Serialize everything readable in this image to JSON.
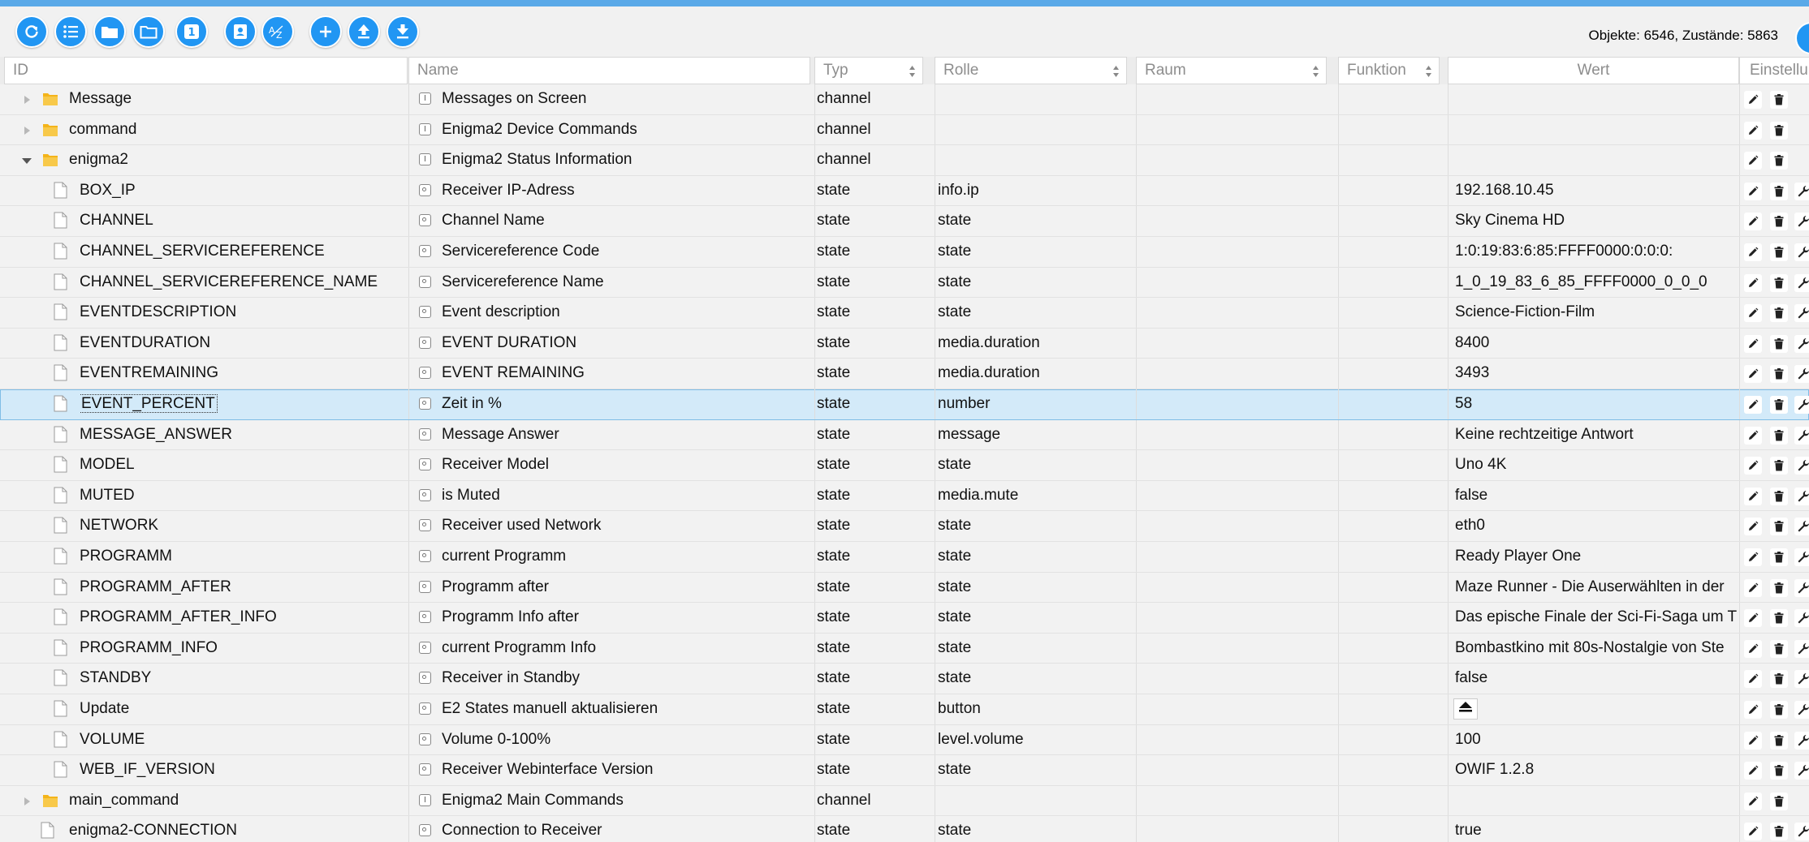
{
  "status": {
    "objects_label": "Objekte: 6546, Zustände: 5863"
  },
  "toolbar": {
    "buttons": [
      {
        "name": "refresh-button",
        "icon": "refresh-icon"
      },
      {
        "name": "list-view-button",
        "icon": "list-icon"
      },
      {
        "name": "folder-closed-button",
        "icon": "folder-icon"
      },
      {
        "name": "folder-open-button",
        "icon": "folder-open-icon"
      },
      {
        "name": "counter-button",
        "icon": "one-badge-icon",
        "label": "1"
      },
      {
        "name": "contact-card-button",
        "icon": "contact-card-icon"
      },
      {
        "name": "sort-az-button",
        "icon": "sort-az-icon",
        "label": "AZ"
      },
      {
        "name": "add-button",
        "icon": "plus-icon"
      },
      {
        "name": "upload-button",
        "icon": "upload-icon"
      },
      {
        "name": "download-button",
        "icon": "download-icon"
      }
    ]
  },
  "columns": {
    "id": "ID",
    "name": "Name",
    "typ": "Typ",
    "rolle": "Rolle",
    "raum": "Raum",
    "funktion": "Funktion",
    "wert": "Wert",
    "settings": "Einstellungen"
  },
  "rows": [
    {
      "id": "Message",
      "name": "Messages on Screen",
      "typ": "channel",
      "rolle": "",
      "wert": "",
      "kind": "folder",
      "indent": 1,
      "expander": "closed"
    },
    {
      "id": "command",
      "name": "Enigma2 Device Commands",
      "typ": "channel",
      "rolle": "",
      "wert": "",
      "kind": "folder",
      "indent": 1,
      "expander": "closed"
    },
    {
      "id": "enigma2",
      "name": "Enigma2 Status Information",
      "typ": "channel",
      "rolle": "",
      "wert": "",
      "kind": "folder",
      "indent": 1,
      "expander": "open"
    },
    {
      "id": "BOX_IP",
      "name": "Receiver IP-Adress",
      "typ": "state",
      "rolle": "info.ip",
      "wert": "192.168.10.45",
      "kind": "file",
      "indent": 2
    },
    {
      "id": "CHANNEL",
      "name": "Channel Name",
      "typ": "state",
      "rolle": "state",
      "wert": "Sky Cinema HD",
      "kind": "file",
      "indent": 2
    },
    {
      "id": "CHANNEL_SERVICEREFERENCE",
      "name": "Servicereference Code",
      "typ": "state",
      "rolle": "state",
      "wert": "1:0:19:83:6:85:FFFF0000:0:0:0:",
      "kind": "file",
      "indent": 2
    },
    {
      "id": "CHANNEL_SERVICEREFERENCE_NAME",
      "name": "Servicereference Name",
      "typ": "state",
      "rolle": "state",
      "wert": "1_0_19_83_6_85_FFFF0000_0_0_0",
      "kind": "file",
      "indent": 2
    },
    {
      "id": "EVENTDESCRIPTION",
      "name": "Event description",
      "typ": "state",
      "rolle": "state",
      "wert": "Science-Fiction-Film",
      "kind": "file",
      "indent": 2
    },
    {
      "id": "EVENTDURATION",
      "name": "EVENT DURATION",
      "typ": "state",
      "rolle": "media.duration",
      "wert": "8400",
      "kind": "file",
      "indent": 2
    },
    {
      "id": "EVENTREMAINING",
      "name": "EVENT REMAINING",
      "typ": "state",
      "rolle": "media.duration",
      "wert": "3493",
      "kind": "file",
      "indent": 2
    },
    {
      "id": "EVENT_PERCENT",
      "name": "Zeit in %",
      "typ": "state",
      "rolle": "number",
      "wert": "58",
      "kind": "file",
      "indent": 2,
      "selected": true
    },
    {
      "id": "MESSAGE_ANSWER",
      "name": "Message Answer",
      "typ": "state",
      "rolle": "message",
      "wert": "Keine rechtzeitige Antwort",
      "kind": "file",
      "indent": 2
    },
    {
      "id": "MODEL",
      "name": "Receiver Model",
      "typ": "state",
      "rolle": "state",
      "wert": "Uno 4K",
      "kind": "file",
      "indent": 2
    },
    {
      "id": "MUTED",
      "name": "is Muted",
      "typ": "state",
      "rolle": "media.mute",
      "wert": "false",
      "kind": "file",
      "indent": 2
    },
    {
      "id": "NETWORK",
      "name": "Receiver used Network",
      "typ": "state",
      "rolle": "state",
      "wert": "eth0",
      "kind": "file",
      "indent": 2
    },
    {
      "id": "PROGRAMM",
      "name": "current Programm",
      "typ": "state",
      "rolle": "state",
      "wert": "Ready Player One",
      "kind": "file",
      "indent": 2
    },
    {
      "id": "PROGRAMM_AFTER",
      "name": "Programm after",
      "typ": "state",
      "rolle": "state",
      "wert": "Maze Runner - Die Auserwählten in der",
      "kind": "file",
      "indent": 2
    },
    {
      "id": "PROGRAMM_AFTER_INFO",
      "name": "Programm Info after",
      "typ": "state",
      "rolle": "state",
      "wert": "Das epische Finale der Sci-Fi-Saga um T",
      "kind": "file",
      "indent": 2
    },
    {
      "id": "PROGRAMM_INFO",
      "name": "current Programm Info",
      "typ": "state",
      "rolle": "state",
      "wert": "Bombastkino mit 80s-Nostalgie von Ste",
      "kind": "file",
      "indent": 2
    },
    {
      "id": "STANDBY",
      "name": "Receiver in Standby",
      "typ": "state",
      "rolle": "state",
      "wert": "false",
      "kind": "file",
      "indent": 2
    },
    {
      "id": "Update",
      "name": "E2 States manuell aktualisieren",
      "typ": "state",
      "rolle": "button",
      "wert": "",
      "kind": "file",
      "indent": 2,
      "eject": true
    },
    {
      "id": "VOLUME",
      "name": "Volume 0-100%",
      "typ": "state",
      "rolle": "level.volume",
      "wert": "100",
      "kind": "file",
      "indent": 2
    },
    {
      "id": "WEB_IF_VERSION",
      "name": "Receiver Webinterface Version",
      "typ": "state",
      "rolle": "state",
      "wert": "OWIF 1.2.8",
      "kind": "file",
      "indent": 2
    },
    {
      "id": "main_command",
      "name": "Enigma2 Main Commands",
      "typ": "channel",
      "rolle": "",
      "wert": "",
      "kind": "folder",
      "indent": 1,
      "expander": "closed"
    },
    {
      "id": "enigma2-CONNECTION",
      "name": "Connection to Receiver",
      "typ": "state",
      "rolle": "state",
      "wert": "true",
      "kind": "file",
      "indent": 1
    }
  ],
  "colors": {
    "accent": "#2196f3",
    "selected_row": "#d3eaf9",
    "folder": "#f4b41a"
  },
  "icons": {
    "edit": "pencil-icon",
    "delete": "trash-icon",
    "settings": "wrench-icon",
    "eject": "eject-icon"
  }
}
